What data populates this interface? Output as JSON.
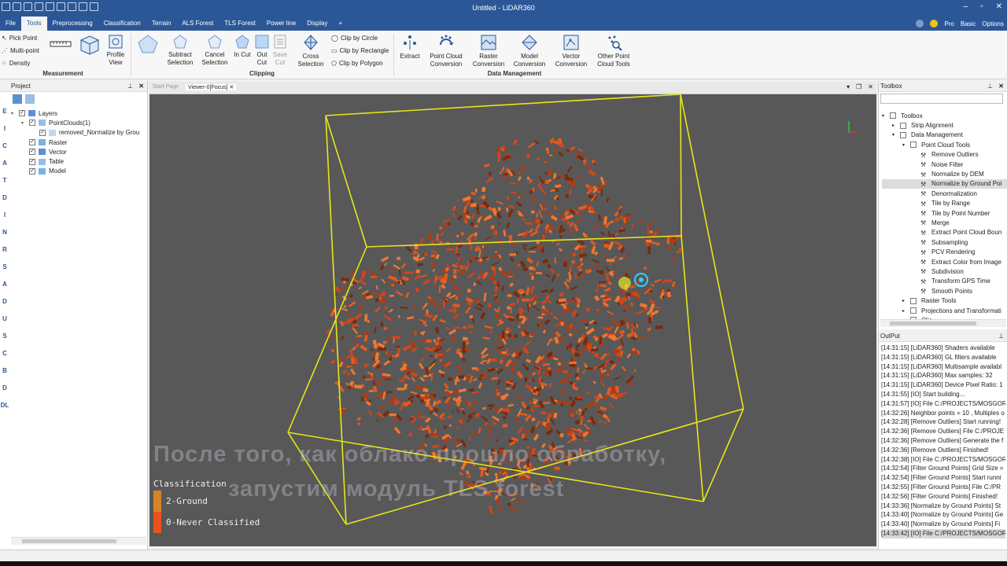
{
  "window": {
    "title": "Untitled - LiDAR360"
  },
  "menu": {
    "tabs": [
      "File",
      "Tools",
      "Preprocessing",
      "Classification",
      "Terrain",
      "ALS Forest",
      "TLS Forest",
      "Power line",
      "Display",
      "+"
    ],
    "active_tab": "Tools",
    "right": {
      "pro": "Pro",
      "basic": "Basic",
      "options": "Options"
    }
  },
  "ribbon": {
    "measurement": {
      "pick_point": "Pick Point",
      "multi_point": "Multi-point",
      "density": "Density",
      "profile_view": "Profile View",
      "group": "Measurement"
    },
    "clipping": {
      "subtract": "Subtract Selection",
      "cancel": "Cancel Selection",
      "in_cut": "In Cut",
      "out_cut": "Out Cut",
      "save_cut": "Save Cut",
      "cross": "Cross Selection",
      "clip_circle": "Clip by Circle",
      "clip_rect": "Clip by Rectangle",
      "clip_polygon": "Clip by Polygon",
      "group": "Clipping"
    },
    "data_management": {
      "extract": "Extract",
      "pc_conv": "Point Cloud Conversion",
      "raster_conv": "Raster Conversion",
      "model_conv": "Model Conversion",
      "vector_conv": "Vector Conversion",
      "other_tools": "Other Point Cloud Tools",
      "group": "Data Management"
    }
  },
  "project": {
    "title": "Project",
    "tree": [
      {
        "label": "Layers",
        "level": 0
      },
      {
        "label": "PointClouds(1)",
        "level": 1
      },
      {
        "label": "removed_Normalize by Grou",
        "level": 2
      },
      {
        "label": "Raster",
        "level": 1
      },
      {
        "label": "Vector",
        "level": 1
      },
      {
        "label": "Table",
        "level": 1
      },
      {
        "label": "Model",
        "level": 1
      }
    ]
  },
  "left_strip": [
    "E",
    "I",
    "C",
    "A",
    "T",
    "D",
    "I",
    "N",
    "R",
    "S",
    "A",
    "D",
    "U",
    "S",
    "C",
    "B",
    "D",
    "DL"
  ],
  "viewer": {
    "tabs": [
      "Start Page",
      "Viewer-0[Focus]"
    ],
    "legend": {
      "title": "Classification",
      "items": [
        {
          "label": "2-Ground",
          "color": "#d9822b"
        },
        {
          "label": "0-Never Classified",
          "color": "#e8531c"
        }
      ]
    },
    "subtitle": [
      "После того, как облако прошло обработку,",
      "запустим модуль TLS forest"
    ]
  },
  "toolbox": {
    "title": "Toolbox",
    "items": [
      {
        "label": "Toolbox",
        "level": 0,
        "kind": "root"
      },
      {
        "label": "Strip Alignment",
        "level": 1,
        "kind": "folder"
      },
      {
        "label": "Data Management",
        "level": 1,
        "kind": "folder"
      },
      {
        "label": "Point Cloud Tools",
        "level": 2,
        "kind": "folder"
      },
      {
        "label": "Remove Outliers",
        "level": 3,
        "kind": "tool"
      },
      {
        "label": "Noise Filter",
        "level": 3,
        "kind": "tool"
      },
      {
        "label": "Normalize by DEM",
        "level": 3,
        "kind": "tool"
      },
      {
        "label": "Normalize by Ground Poi",
        "level": 3,
        "kind": "tool",
        "selected": true
      },
      {
        "label": "Denormalization",
        "level": 3,
        "kind": "tool"
      },
      {
        "label": "Tile by Range",
        "level": 3,
        "kind": "tool"
      },
      {
        "label": "Tile by Point Number",
        "level": 3,
        "kind": "tool"
      },
      {
        "label": "Merge",
        "level": 3,
        "kind": "tool"
      },
      {
        "label": "Extract Point Cloud Boun",
        "level": 3,
        "kind": "tool"
      },
      {
        "label": "Subsampling",
        "level": 3,
        "kind": "tool"
      },
      {
        "label": "PCV Rendering",
        "level": 3,
        "kind": "tool"
      },
      {
        "label": "Extract Color from Image",
        "level": 3,
        "kind": "tool"
      },
      {
        "label": "Subdivision",
        "level": 3,
        "kind": "tool"
      },
      {
        "label": "Transform GPS Time",
        "level": 3,
        "kind": "tool"
      },
      {
        "label": "Smooth Points",
        "level": 3,
        "kind": "tool"
      },
      {
        "label": "Raster Tools",
        "level": 2,
        "kind": "folder"
      },
      {
        "label": "Projections and Transformati",
        "level": 2,
        "kind": "folder"
      },
      {
        "label": "Clip",
        "level": 2,
        "kind": "folder"
      }
    ]
  },
  "output": {
    "title": "OutPut",
    "lines": [
      "[14:31:15] [LiDAR360]    Shaders available",
      "[14:31:15] [LiDAR360]    GL filters available",
      "[14:31:15] [LiDAR360]    Multisample availabl",
      "[14:31:15] [LiDAR360]    Max samples: 32",
      "[14:31:15] [LiDAR360]    Device Pixel Ratio: 1",
      "[14:31:55] [IO]    Start building...",
      "[14:31:57] [IO]    File C:/PROJECTS/MOSGOR",
      "[14:32:26] Neighbor points = 10 , Multiples o",
      "[14:32:28] [Remove Outliers]    Start running!",
      "[14:32:36] [Remove Outliers]    File C:/PROJE",
      "[14:32:36] [Remove Outliers]    Generate the f",
      "[14:32:36] [Remove Outliers]    Finished!",
      "[14:32:38] [IO]    File C:/PROJECTS/MOSGOR",
      "[14:32:54] [Filter Ground Points]    Grid Size =",
      "[14:32:54] [Filter Ground Points]    Start runni",
      "[14:32:55] [Filter Ground Points]    File C:/PR",
      "[14:32:56] [Filter Ground Points]    Finished!",
      "[14:33:36] [Normalize by Ground Points]    St",
      "[14:33:40] [Normalize by Ground Points]    Ge",
      "[14:33:40] [Normalize by Ground Points]    Fi",
      "[14:33:42] [IO]    File C:/PROJECTS/MOSGOR"
    ]
  },
  "colors": {
    "brand": "#2b5797",
    "bbox": "#e6e619",
    "points_dark": "#7a2a0c",
    "points": "#d2451a",
    "points_light": "#f0782f",
    "viewer_bg": "#585858"
  }
}
